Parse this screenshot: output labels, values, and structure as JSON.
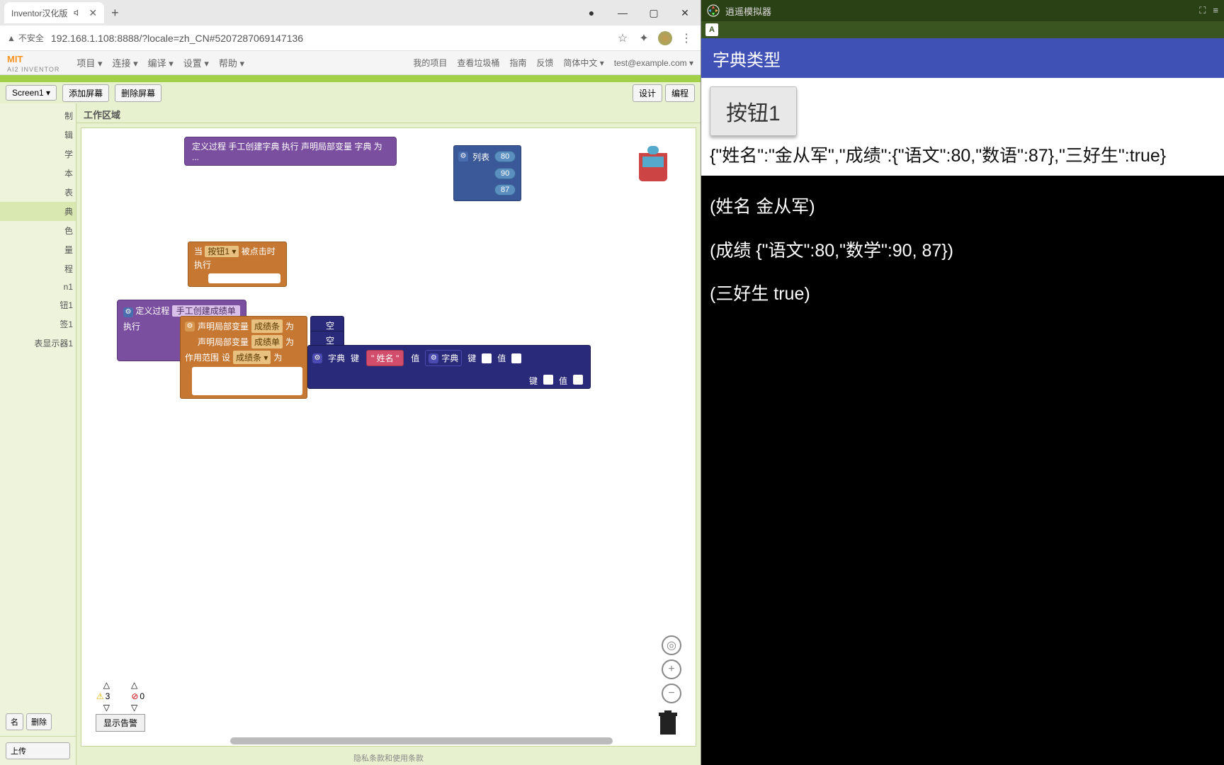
{
  "browser": {
    "tab_title": "Inventor汉化版",
    "ssl_warning": "不安全",
    "url": "192.168.1.108:8888/?locale=zh_CN#5207287069147136"
  },
  "header": {
    "logo_top": "MIT",
    "logo_bot": "AI2 INVENTOR",
    "menus": [
      "项目 ▾",
      "连接 ▾",
      "编译 ▾",
      "设置 ▾",
      "帮助 ▾"
    ],
    "right": {
      "my_proj": "我的项目",
      "trash": "查看垃圾桶",
      "guide": "指南",
      "feedback": "反馈",
      "lang": "简体中文 ▾",
      "user": "test@example.com ▾"
    }
  },
  "project_bar": {
    "screen": "Screen1 ▾",
    "add_screen": "添加屏幕",
    "del_screen": "删除屏幕",
    "design": "设计",
    "blocks": "编程"
  },
  "sidebar": {
    "items": [
      "制",
      "辑",
      "学",
      "本",
      "表",
      "典",
      "色",
      "量",
      "程",
      "n1",
      "钮1",
      "签1",
      "表显示器1"
    ],
    "rename": "名",
    "delete": "删除",
    "upload": "上传"
  },
  "work_area": {
    "title": "工作区域"
  },
  "blocks_code": {
    "top_purple": "定义过程 手工创建字典 执行 声明局部变量 字典 为 ...",
    "list_label": "列表",
    "list_vals": [
      "80",
      "90",
      "87"
    ],
    "when": "当",
    "button_ref": "按钮1 ▾",
    "clicked": "被点击时",
    "do": "执行",
    "proc_def": "定义过程",
    "proc_name": "手工创建成绩单",
    "exec": "执行",
    "decl_local": "声明局部变量",
    "v1": "成绩条",
    "v2": "成绩单",
    "as": "为",
    "empty_dict": "空字典",
    "scope": "作用范围",
    "set": "设",
    "set_var": "成绩条 ▾",
    "dict": "字典",
    "key": "键",
    "key_val": "\" 姓名 \"",
    "value": "值"
  },
  "warning_panel": {
    "warn_count": "3",
    "err_count": "0",
    "show_btn": "显示告警"
  },
  "footer": {
    "text": "隐私条款和使用条款"
  },
  "emulator": {
    "title": "逍遥模拟器",
    "badge": "A",
    "app_title": "字典类型",
    "button1": "按钮1",
    "json_out": "{\"姓名\":\"金从军\",\"成绩\":{\"语文\":80,\"数语\":87},\"三好生\":true}",
    "entry1": "(姓名 金从军)",
    "entry2": "(成绩 {\"语文\":80,\"数学\":90, 87})",
    "entry3": "(三好生 true)"
  }
}
